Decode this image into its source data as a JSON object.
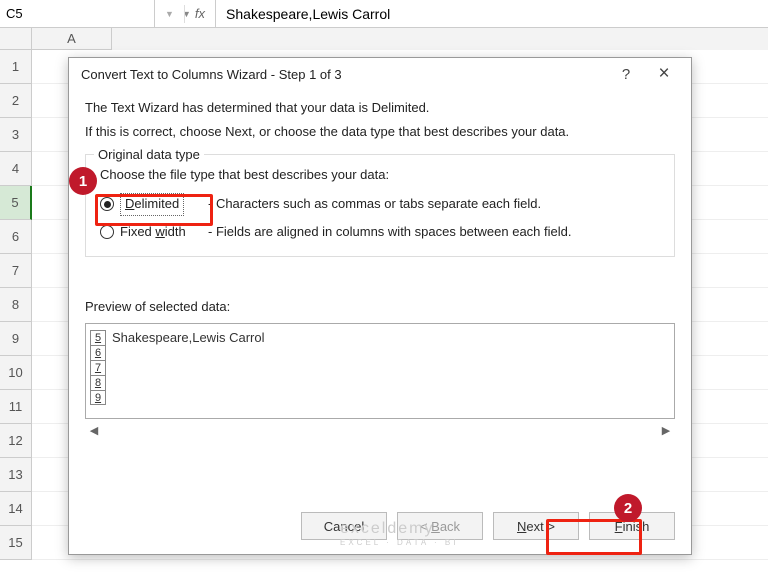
{
  "formula_bar": {
    "cell_ref": "C5",
    "fx_label": "fx",
    "value": "Shakespeare,Lewis Carrol"
  },
  "columns": [
    "A"
  ],
  "rows": [
    "1",
    "2",
    "3",
    "4",
    "5",
    "6",
    "7",
    "8",
    "9",
    "10",
    "11",
    "12",
    "13",
    "14",
    "15"
  ],
  "selected_row": "5",
  "dialog": {
    "title": "Convert Text to Columns Wizard - Step 1 of 3",
    "help": "?",
    "close": "×",
    "intro1": "The Text Wizard has determined that your data is Delimited.",
    "intro2": "If this is correct, choose Next, or choose the data type that best describes your data.",
    "group_legend": "Original data type",
    "group_prompt": "Choose the file type that best describes your data:",
    "radio": {
      "delimited": {
        "label": "Delimited",
        "desc": "- Characters such as commas or tabs separate each field.",
        "selected": true
      },
      "fixed": {
        "label": "Fixed width",
        "desc": "- Fields are aligned in columns with spaces between each field.",
        "selected": false
      }
    },
    "preview_label": "Preview of selected data:",
    "preview_rows": [
      "5",
      "6",
      "7",
      "8",
      "9"
    ],
    "preview_text": "Shakespeare,Lewis Carrol",
    "buttons": {
      "cancel": "Cancel",
      "back": "< Back",
      "next": "Next >",
      "finish": "Finish"
    }
  },
  "callouts": {
    "one": "1",
    "two": "2"
  },
  "watermark": {
    "main": "exceldemy",
    "sub": "EXCEL · DATA · BI"
  }
}
